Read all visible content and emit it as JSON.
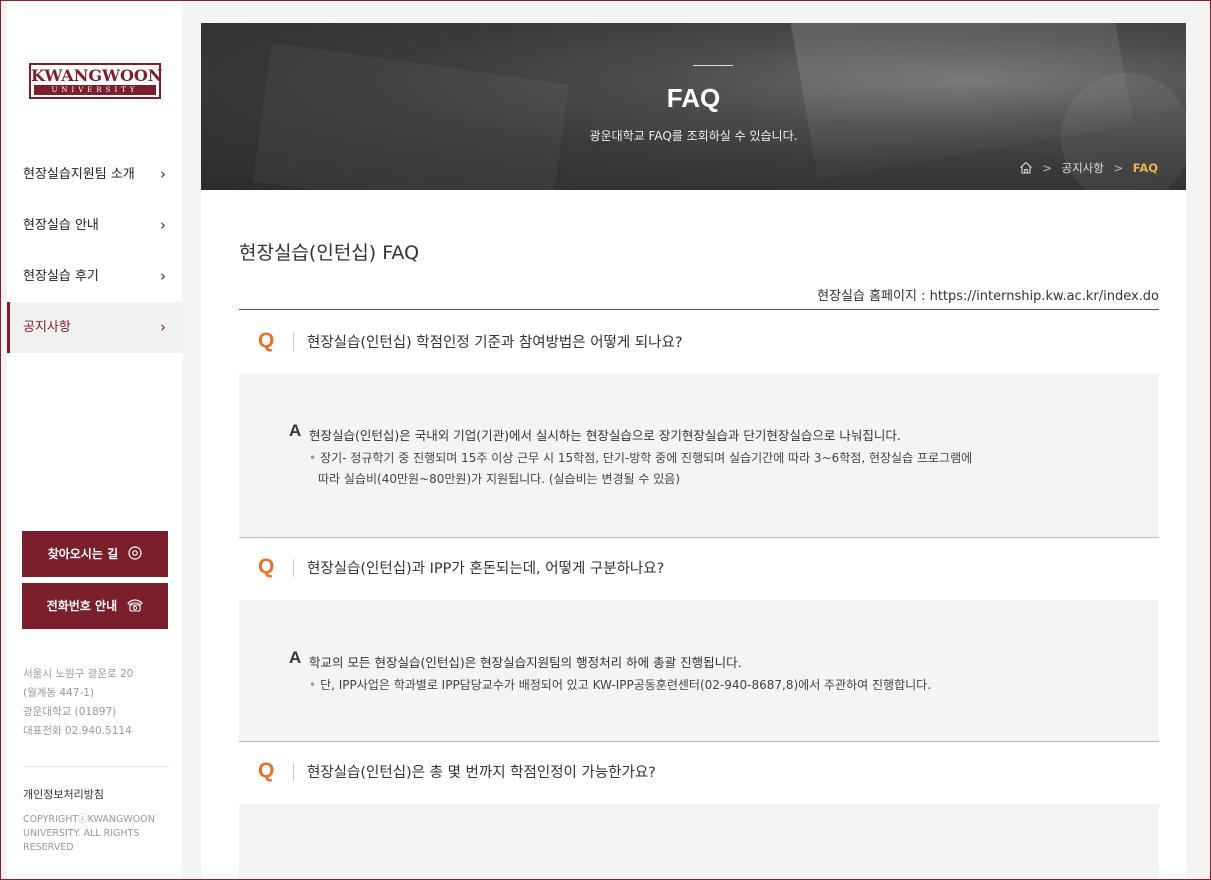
{
  "logo": {
    "name": "KWANGWOON",
    "sub": "UNIVERSITY"
  },
  "sidebar": {
    "items": [
      {
        "label": "현장실습지원팀 소개",
        "chev": "›"
      },
      {
        "label": "현장실습 안내",
        "chev": "›"
      },
      {
        "label": "현장실습 후기",
        "chev": "›"
      },
      {
        "label": "공지사항",
        "chev": "›",
        "active": true
      }
    ],
    "buttons": {
      "directions": "찾아오시는 길",
      "phone": "전화번호 안내"
    },
    "address": [
      "서울시 노원구 광운로 20",
      "(월계동 447-1)",
      "광운대학교 (01897)",
      "대표전화 02.940.5114"
    ],
    "privacy": "개인정보처리방침",
    "copyright": "COPYRIGHTⓒKWANGWOON UNIVERSITY. ALL RIGHTS RESERVED"
  },
  "hero": {
    "title": "FAQ",
    "subtitle": "광운대학교 FAQ를 조회하실 수 있습니다.",
    "breadcrumb": {
      "home_icon": "home-icon",
      "section": "공지사항",
      "current": "FAQ"
    }
  },
  "main": {
    "title": "현장실습(인턴십) FAQ",
    "homepage": "현장실습 홈페이지 : https://internship.kw.ac.kr/index.do"
  },
  "faqs": [
    {
      "q_mark": "Q",
      "question": "현장실습(인턴십) 학점인정 기준과 참여방법은 어떻게 되나요?",
      "a_mark": "A",
      "answer": "현장실습(인턴십)은 국내외 기업(기관)에서 실시하는 현장실습으로 장기현장실습과 단기현장실습으로 나눠집니다.",
      "details": [
        "장기- 정규학기 중 진행되며 15주 이상 근무 시 15학점, 단기-방학 중에 진행되며 실습기간에 따라 3~6학점, 현장실습 프로그램에",
        "따라 실습비(40만원~80만원)가 지원됩니다. (실습비는 변경될 수 있음)"
      ]
    },
    {
      "q_mark": "Q",
      "question": "현장실습(인턴십)과 IPP가 혼돈되는데, 어떻게 구분하나요?",
      "a_mark": "A",
      "answer": "학교의 모든 현장실습(인턴십)은 현장실습지원팀의 행정처리 하에 총괄 진행됩니다.",
      "details": [
        "단, IPP사업은 학과별로 IPP담당교수가 배정되어 있고 KW-IPP공동훈련센터(02-940-8687,8)에서 주관하여 진행합니다."
      ]
    },
    {
      "q_mark": "Q",
      "question": "현장실습(인턴십)은 총 몇 번까지 학점인정이 가능한가요?"
    }
  ],
  "colors": {
    "brand": "#7a1f2b",
    "accent": "#e8702a",
    "crumb_current": "#f0b24c"
  }
}
